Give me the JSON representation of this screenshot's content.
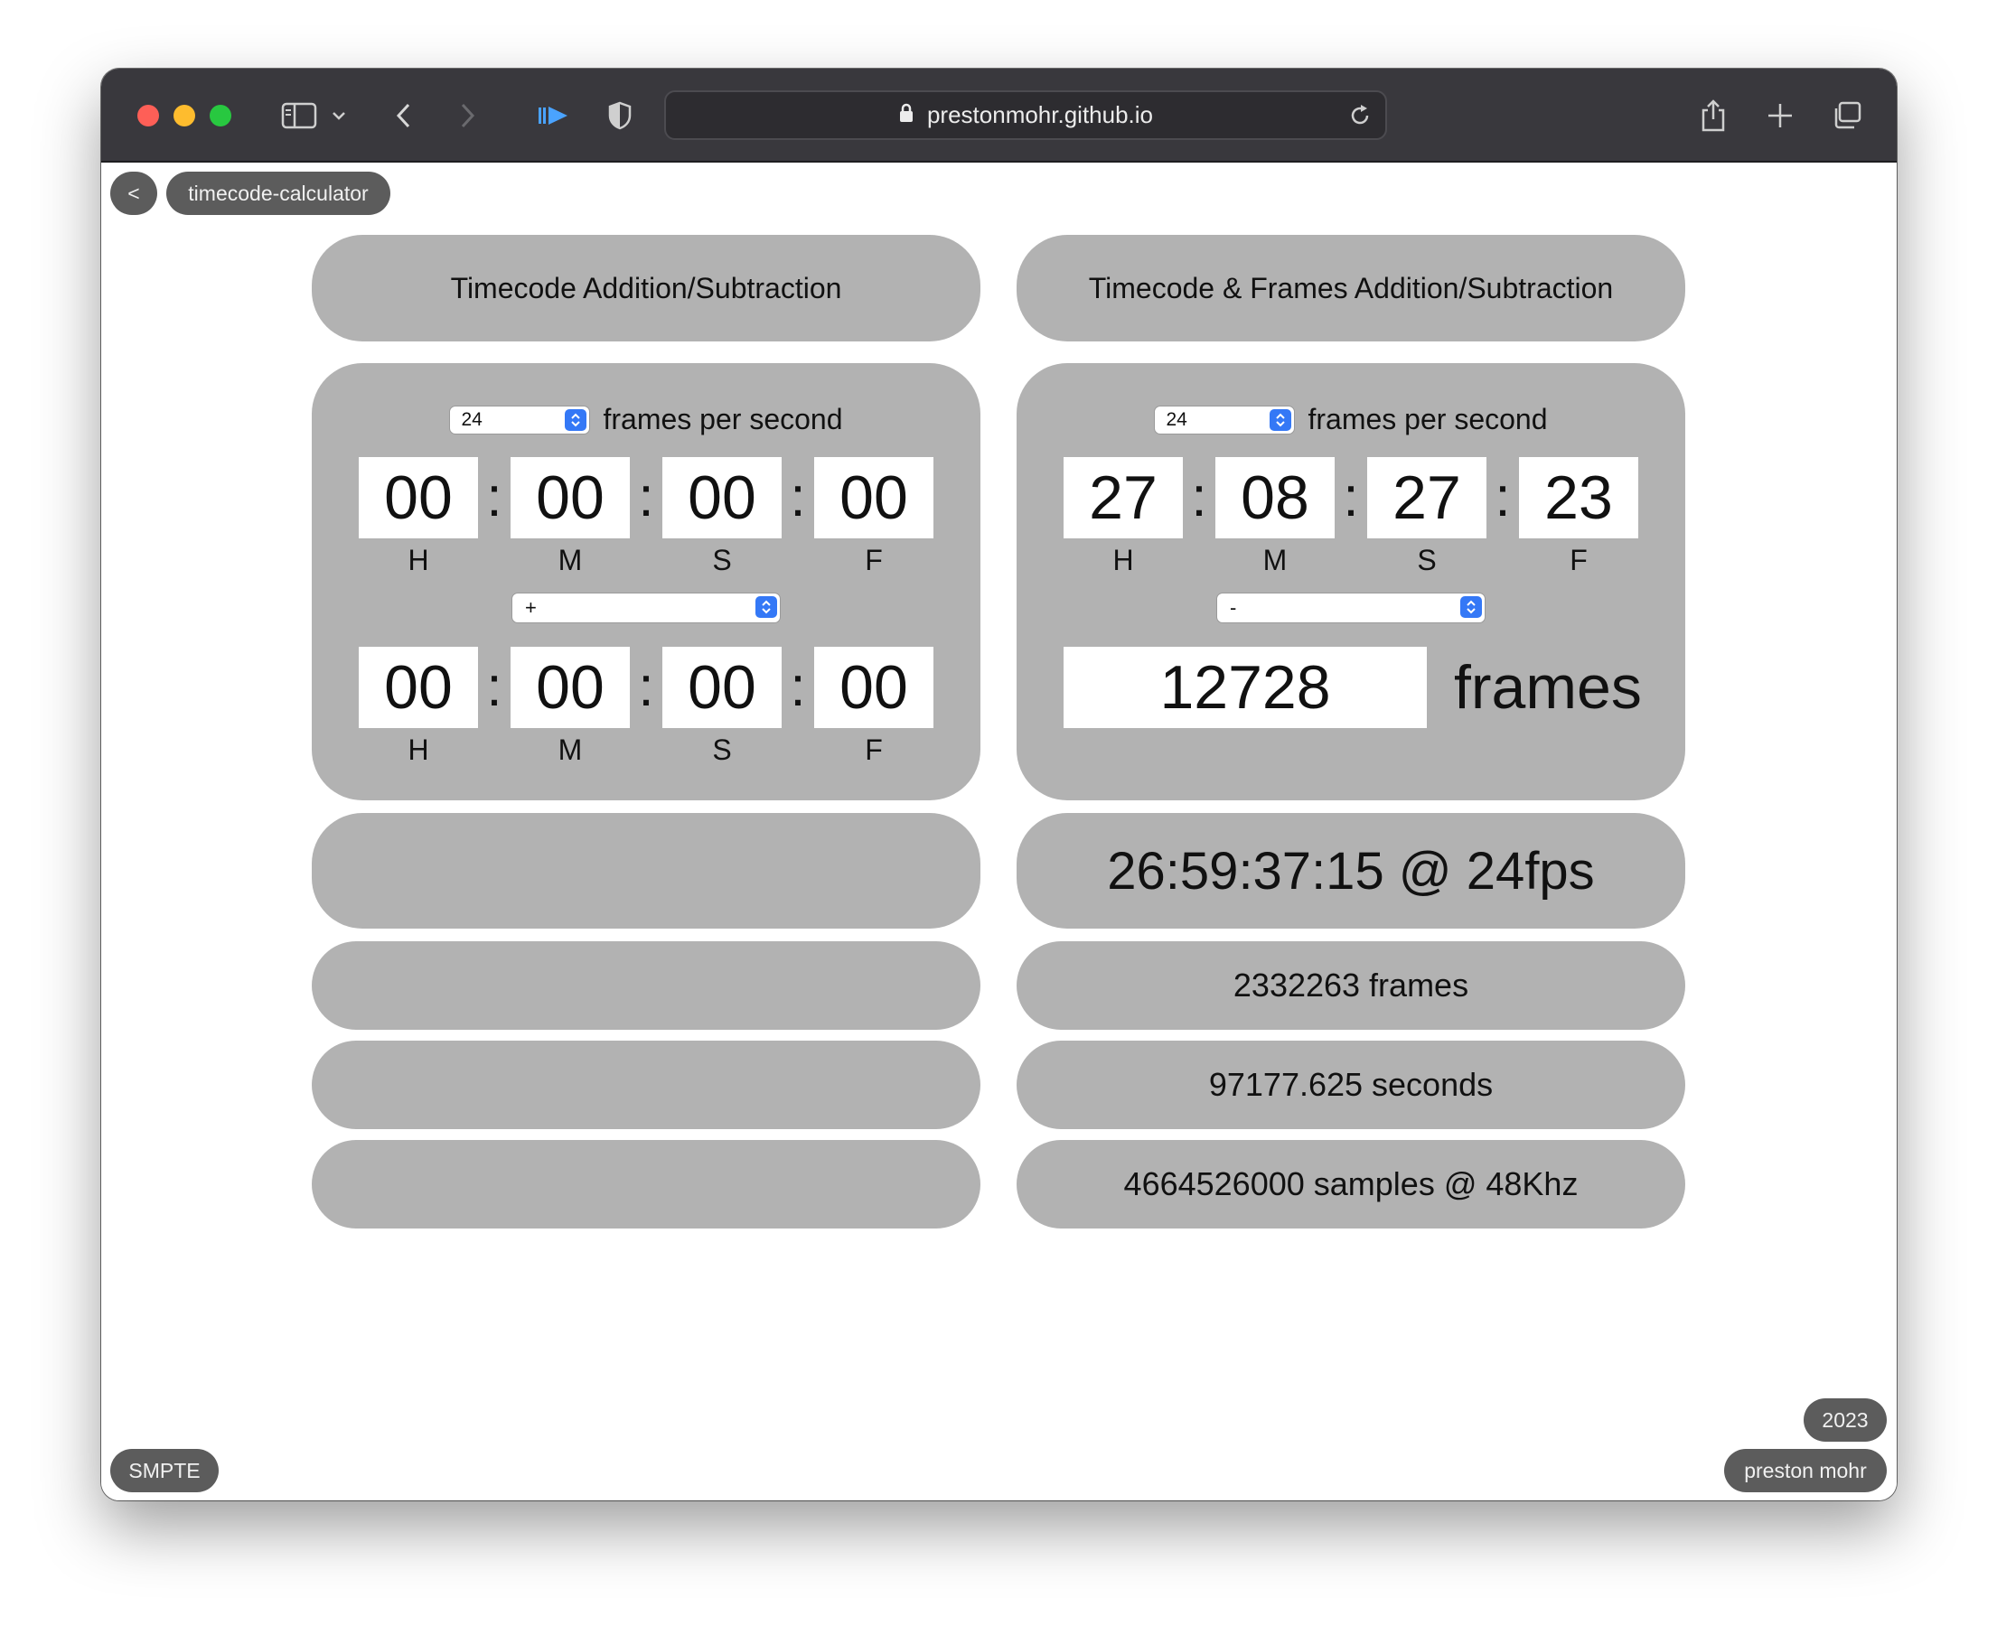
{
  "browser": {
    "url": "prestonmohr.github.io"
  },
  "header": {
    "back_label": "<",
    "title": "timecode-calculator"
  },
  "left": {
    "title": "Timecode Addition/Subtraction",
    "fps_value": "24",
    "fps_label": "frames per second",
    "tc1": {
      "h": "00",
      "m": "00",
      "s": "00",
      "f": "00"
    },
    "operator": "+",
    "tc2": {
      "h": "00",
      "m": "00",
      "s": "00",
      "f": "00"
    },
    "units": {
      "h": "H",
      "m": "M",
      "s": "S",
      "f": "F"
    },
    "separator": ":",
    "results": [
      "",
      "",
      "",
      ""
    ]
  },
  "right": {
    "title": "Timecode & Frames Addition/Subtraction",
    "fps_value": "24",
    "fps_label": "frames per second",
    "tc1": {
      "h": "27",
      "m": "08",
      "s": "27",
      "f": "23"
    },
    "operator": "-",
    "frames_value": "12728",
    "frames_word": "frames",
    "results": {
      "timecode": "26:59:37:15 @ 24fps",
      "frames": "2332263 frames",
      "seconds": "97177.625 seconds",
      "samples": "4664526000 samples @ 48Khz"
    }
  },
  "footer": {
    "standard": "SMPTE",
    "year": "2023",
    "author": "preston mohr"
  },
  "colors": {
    "card": "#b2b2b2",
    "pill": "#5c5c5c",
    "titlebar": "#39383d",
    "accent": "#3478f6"
  }
}
